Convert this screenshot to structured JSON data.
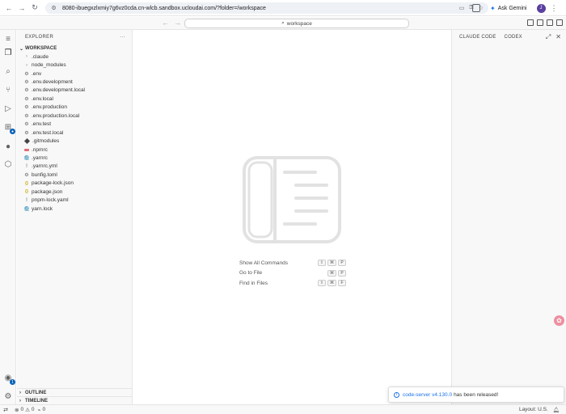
{
  "browser": {
    "url": "8080-ibuegxzlxmiy7g6vz0cda.cn-wlcb.sandbox.ucloudai.com/?folder=/workspace",
    "gemini_label": "Ask Gemini",
    "avatar_letter": "J"
  },
  "titlebar": {
    "search_label": "workspace"
  },
  "explorer": {
    "title": "EXPLORER",
    "workspace": "WORKSPACE",
    "items": [
      {
        "label": ".claude",
        "icon": "folder-chevron"
      },
      {
        "label": "node_modules",
        "icon": "folder-chevron"
      },
      {
        "label": ".env",
        "icon": "gear"
      },
      {
        "label": ".env.development",
        "icon": "gear"
      },
      {
        "label": ".env.development.local",
        "icon": "gear"
      },
      {
        "label": ".env.local",
        "icon": "gear"
      },
      {
        "label": ".env.production",
        "icon": "gear"
      },
      {
        "label": ".env.production.local",
        "icon": "gear"
      },
      {
        "label": ".env.test",
        "icon": "gear"
      },
      {
        "label": ".env.test.local",
        "icon": "gear"
      },
      {
        "label": ".gitmodules",
        "icon": "git"
      },
      {
        "label": ".npmrc",
        "icon": "npm"
      },
      {
        "label": ".yarnrc",
        "icon": "yarn"
      },
      {
        "label": ".yarnrc.yml",
        "icon": "exclamation"
      },
      {
        "label": "bunfig.toml",
        "icon": "gear"
      },
      {
        "label": "package-lock.json",
        "icon": "json"
      },
      {
        "label": "package.json",
        "icon": "json"
      },
      {
        "label": "pnpm-lock.yaml",
        "icon": "exclamation"
      },
      {
        "label": "yarn.lock",
        "icon": "yarn"
      }
    ],
    "outline": "OUTLINE",
    "timeline": "TIMELINE"
  },
  "editor": {
    "shortcuts": [
      {
        "label": "Show All Commands",
        "keys": [
          "⇧",
          "⌘",
          "P"
        ]
      },
      {
        "label": "Go to File",
        "keys": [
          "⌘",
          "P"
        ]
      },
      {
        "label": "Find in Files",
        "keys": [
          "⇧",
          "⌘",
          "F"
        ]
      }
    ]
  },
  "right_panel": {
    "tab1": "CLAUDE CODE",
    "tab2": "CODEX"
  },
  "notification": {
    "link": "code-server v4.130.0",
    "text": "has been released!"
  },
  "statusbar": {
    "errors": "0",
    "warnings": "0",
    "ports": "0",
    "layout": "Layout: U.S."
  },
  "colors": {
    "accent": "#005fb8",
    "link": "#1a73e8",
    "float_button": "#ec8fa0"
  }
}
